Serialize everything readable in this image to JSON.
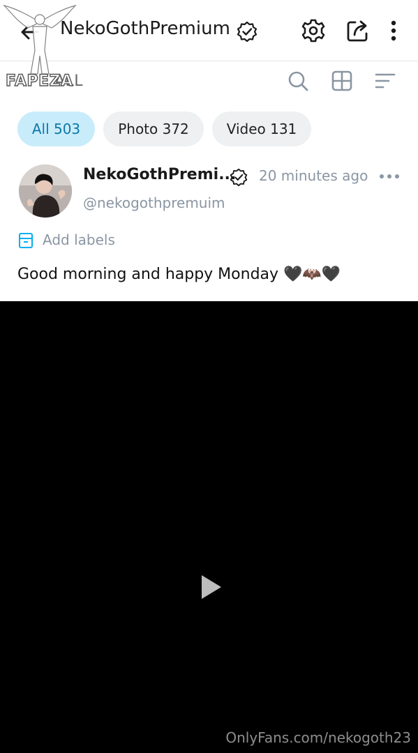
{
  "header": {
    "title": "NekoGothPremium",
    "icons": [
      "back-arrow-icon",
      "verified-badge-icon",
      "gear-icon",
      "share-icon",
      "more-vertical-icon"
    ]
  },
  "subbar": {
    "title": "ALL",
    "icons": [
      "search-icon",
      "grid-icon",
      "sort-icon"
    ]
  },
  "tabs": [
    {
      "label": "All 503",
      "active": true
    },
    {
      "label": "Photo 372",
      "active": false
    },
    {
      "label": "Video 131",
      "active": false
    }
  ],
  "post": {
    "author": "NekoGothPremi...",
    "time": "20 minutes ago",
    "handle": "@nekogothpremuim",
    "add_labels": "Add labels",
    "text": "Good morning and happy Monday 🖤🦇🖤"
  },
  "video": {
    "play_icon": "play-icon"
  },
  "watermarks": {
    "logo_text": "FAPEZA",
    "bottom": "OnlyFans.com/nekogoth23"
  },
  "colors": {
    "accent": "#00aff0",
    "active_chip_bg": "#c9ecfb",
    "chip_bg": "#eef0f2",
    "muted_text": "#8a96a3"
  }
}
